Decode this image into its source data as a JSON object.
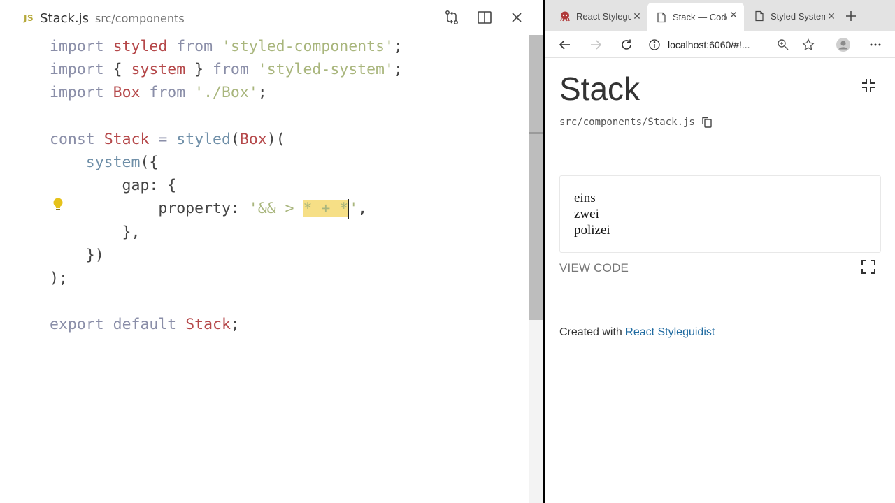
{
  "editor": {
    "tab": {
      "badge": "JS",
      "filename": "Stack.js",
      "path": "src/components"
    },
    "lines": [
      [
        [
          "kw",
          "import"
        ],
        [
          "plain",
          " "
        ],
        [
          "id",
          "styled"
        ],
        [
          "plain",
          " "
        ],
        [
          "kw",
          "from"
        ],
        [
          "plain",
          " "
        ],
        [
          "str",
          "'styled-components'"
        ],
        [
          "plain",
          ";"
        ]
      ],
      [
        [
          "kw",
          "import"
        ],
        [
          "plain",
          " { "
        ],
        [
          "id",
          "system"
        ],
        [
          "plain",
          " } "
        ],
        [
          "kw",
          "from"
        ],
        [
          "plain",
          " "
        ],
        [
          "str",
          "'styled-system'"
        ],
        [
          "plain",
          ";"
        ]
      ],
      [
        [
          "kw",
          "import"
        ],
        [
          "plain",
          " "
        ],
        [
          "id",
          "Box"
        ],
        [
          "plain",
          " "
        ],
        [
          "kw",
          "from"
        ],
        [
          "plain",
          " "
        ],
        [
          "str",
          "'./Box'"
        ],
        [
          "plain",
          ";"
        ]
      ],
      [],
      [
        [
          "kw",
          "const"
        ],
        [
          "plain",
          " "
        ],
        [
          "id",
          "Stack"
        ],
        [
          "plain",
          " "
        ],
        [
          "kw",
          "="
        ],
        [
          "plain",
          " "
        ],
        [
          "fn",
          "styled"
        ],
        [
          "plain",
          "("
        ],
        [
          "id",
          "Box"
        ],
        [
          "plain",
          ")("
        ]
      ],
      [
        [
          "plain",
          "    "
        ],
        [
          "fn",
          "system"
        ],
        [
          "plain",
          "({"
        ]
      ],
      [
        [
          "plain",
          "        gap: {"
        ]
      ],
      [
        [
          "plain",
          "            property: "
        ],
        [
          "str",
          "'&& > "
        ],
        [
          "sel",
          "* + *"
        ],
        [
          "cursor",
          ""
        ],
        [
          "str",
          "'"
        ],
        [
          "plain",
          ","
        ]
      ],
      [
        [
          "plain",
          "        },"
        ]
      ],
      [
        [
          "plain",
          "    })"
        ]
      ],
      [
        [
          "plain",
          ");"
        ]
      ],
      [],
      [
        [
          "kw",
          "export"
        ],
        [
          "plain",
          " "
        ],
        [
          "kw",
          "default"
        ],
        [
          "plain",
          " "
        ],
        [
          "id",
          "Stack"
        ],
        [
          "plain",
          ";"
        ]
      ]
    ]
  },
  "browser": {
    "tabs": [
      {
        "title": "React Styleguidist",
        "active": false
      },
      {
        "title": "Stack — Code",
        "active": true
      },
      {
        "title": "Styled System",
        "active": false
      }
    ],
    "address": "localhost:6060/#!...",
    "page": {
      "title": "Stack",
      "path": "src/components/Stack.js",
      "preview_items": [
        "eins",
        "zwei",
        "polizei"
      ],
      "view_code": "VIEW CODE",
      "footer_prefix": "Created with ",
      "footer_link": "React Styleguidist"
    }
  },
  "colors": {
    "keyword": "#8a8ea8",
    "identifier": "#b5484a",
    "string": "#a9b67d",
    "function": "#6f8fa8",
    "selection": "#f6df86",
    "link": "#1f6aa0"
  }
}
